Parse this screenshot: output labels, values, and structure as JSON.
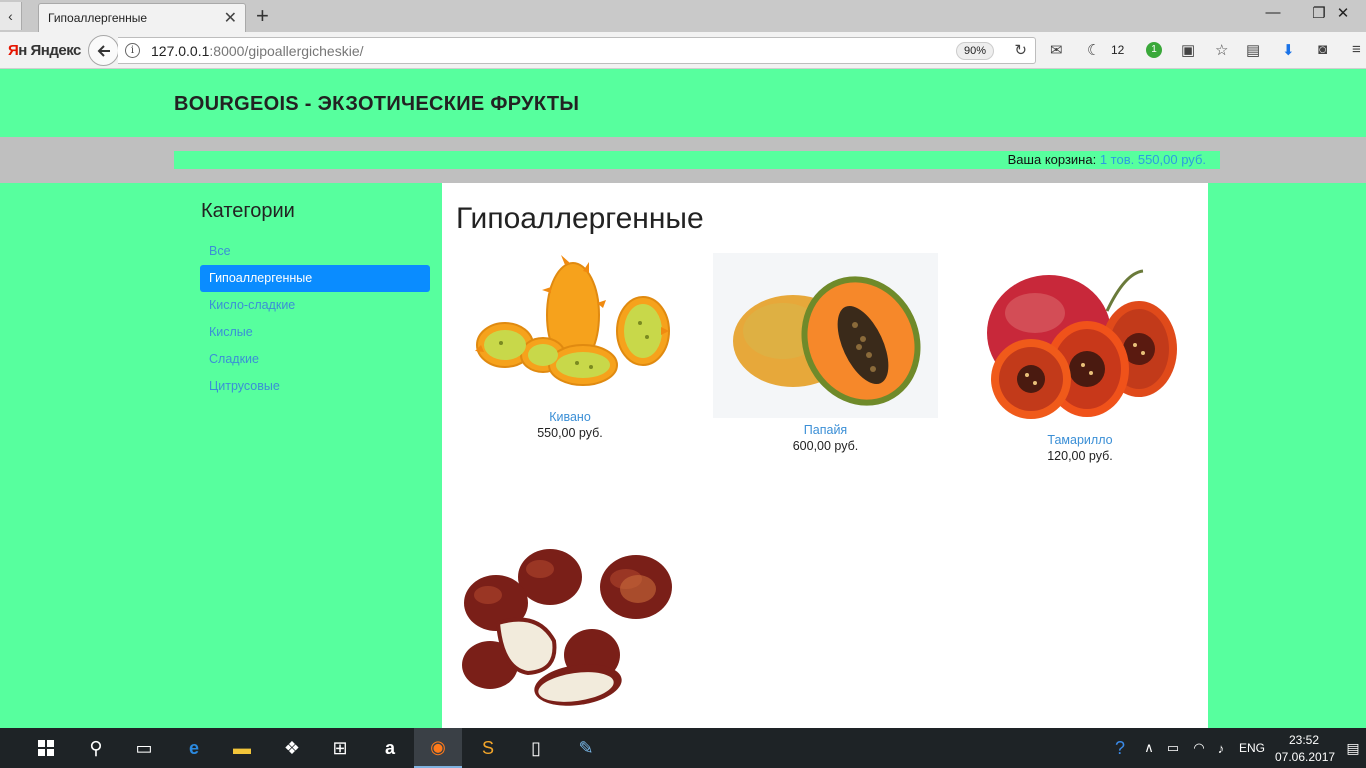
{
  "browser": {
    "tab_title": "Гипоаллергенные",
    "url_host": "127.0.0.1",
    "url_rest": ":8000/gipoallergicheskie/",
    "zoom": "90%",
    "logo_ya": "Я",
    "logo_text": "н Яндекс",
    "notification_count": "12",
    "extension_badge": "1"
  },
  "site": {
    "title": "BOURGEOIS - ЭКЗОТИЧЕСКИЕ ФРУКТЫ",
    "cart_label": "Ваша корзина:",
    "cart_value": "1 тов. 550,00 руб."
  },
  "sidebar": {
    "heading": "Категории",
    "items": [
      {
        "label": "Все"
      },
      {
        "label": "Гипоаллергенные"
      },
      {
        "label": "Кисло-сладкие"
      },
      {
        "label": "Кислые"
      },
      {
        "label": "Сладкие"
      },
      {
        "label": "Цитрусовые"
      }
    ]
  },
  "main": {
    "title": "Гипоаллергенные",
    "products": [
      {
        "name": "Кивано",
        "price": "550,00 руб."
      },
      {
        "name": "Папайя",
        "price": "600,00 руб."
      },
      {
        "name": "Тамарилло",
        "price": "120,00 руб."
      },
      {
        "name": "",
        "price": ""
      }
    ]
  },
  "taskbar": {
    "lang": "ENG",
    "time": "23:52",
    "date": "07.06.2017"
  }
}
